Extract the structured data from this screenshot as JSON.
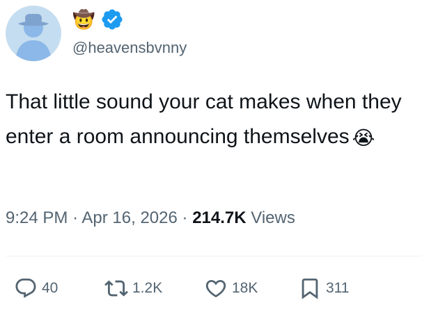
{
  "user": {
    "name_emoji": "🤠",
    "handle": "@heavensbvnny",
    "verified": true,
    "colors": {
      "verified": "#1d9bf0",
      "avatar_bg": "#c5ddf0",
      "avatar_fg": "#8bb8e8"
    }
  },
  "tweet": {
    "text": "That little sound your cat makes when they enter a room announcing themselves",
    "emoji": "😭"
  },
  "meta": {
    "time": "9:24 PM",
    "separator": "·",
    "date": "Apr 16, 2026",
    "views_count": "214.7K",
    "views_label": "Views"
  },
  "actions": {
    "reply": {
      "icon": "reply-icon",
      "count": "40"
    },
    "retweet": {
      "icon": "retweet-icon",
      "count": "1.2K"
    },
    "like": {
      "icon": "heart-icon",
      "count": "18K"
    },
    "bookmark": {
      "icon": "bookmark-icon",
      "count": "311"
    }
  }
}
